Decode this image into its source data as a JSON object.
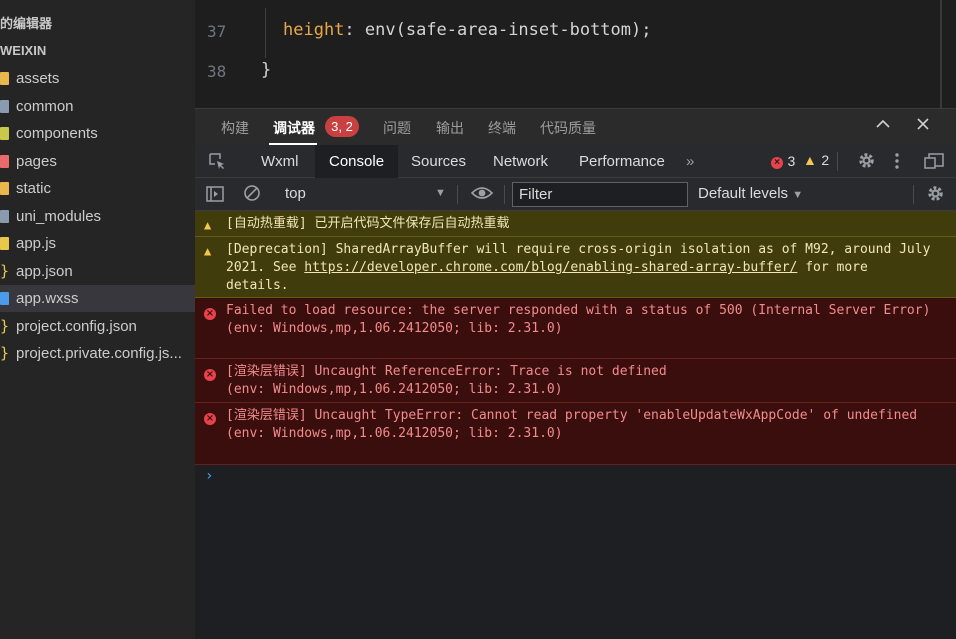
{
  "sidebar": {
    "header1": "的编辑器",
    "header2": "WEIXIN",
    "items": [
      {
        "label": "assets",
        "icon": "folder-icon",
        "color": "#e8b84a"
      },
      {
        "label": "common",
        "icon": "folder-icon",
        "color": "#8a9bb0"
      },
      {
        "label": "components",
        "icon": "folder-icon",
        "color": "#c8c84a"
      },
      {
        "label": "pages",
        "icon": "folder-icon",
        "color": "#e86a6a"
      },
      {
        "label": "static",
        "icon": "folder-icon",
        "color": "#e8b84a"
      },
      {
        "label": "uni_modules",
        "icon": "folder-icon",
        "color": "#8a9bb0"
      },
      {
        "label": "app.js",
        "icon": "js-file-icon",
        "color": "#e8c84a"
      },
      {
        "label": "app.json",
        "icon": "json-file-icon",
        "color": "#e8c84a"
      },
      {
        "label": "app.wxss",
        "icon": "css-file-icon",
        "color": "#4a9be8"
      },
      {
        "label": "project.config.json",
        "icon": "json-file-icon",
        "color": "#e8c84a"
      },
      {
        "label": "project.private.config.js...",
        "icon": "json-file-icon",
        "color": "#e8c84a"
      }
    ],
    "selected_index": 8
  },
  "editor": {
    "lines": [
      {
        "num": "37",
        "prop": "height",
        "value": "env(safe-area-inset-bottom)"
      },
      {
        "num": "38",
        "text": "}"
      }
    ]
  },
  "panel": {
    "tabs": [
      "构建",
      "调试器",
      "问题",
      "输出",
      "终端",
      "代码质量"
    ],
    "active_tab": "调试器",
    "badge": "3, 2"
  },
  "devtools": {
    "tabs": [
      "Wxml",
      "Console",
      "Sources",
      "Network",
      "Performance"
    ],
    "active_tab": "Console",
    "error_count": "3",
    "warning_count": "2"
  },
  "toolbar": {
    "context": "top",
    "filter_placeholder": "Filter",
    "levels": "Default levels"
  },
  "console": {
    "messages": [
      {
        "level": "warning",
        "text": "[自动热重载] 已开启代码文件保存后自动热重载"
      },
      {
        "level": "warning",
        "text_before": "[Deprecation] SharedArrayBuffer will require cross-origin isolation as of M92, around July 2021. See ",
        "link": "https://developer.chrome.com/blog/enabling-shared-array-buffer/",
        "text_after": " for more details."
      },
      {
        "level": "error",
        "text": "Failed to load resource: the server responded with a status of 500 (Internal Server Error)",
        "env": "(env: Windows,mp,1.06.2412050; lib: 2.31.0)"
      },
      {
        "level": "error",
        "text": "[渲染层错误] Uncaught ReferenceError: Trace is not defined",
        "env": "(env: Windows,mp,1.06.2412050; lib: 2.31.0)"
      },
      {
        "level": "error",
        "text": "[渲染层错误] Uncaught TypeError: Cannot read property 'enableUpdateWxAppCode' of undefined",
        "env": "(env: Windows,mp,1.06.2412050; lib: 2.31.0)"
      }
    ]
  }
}
